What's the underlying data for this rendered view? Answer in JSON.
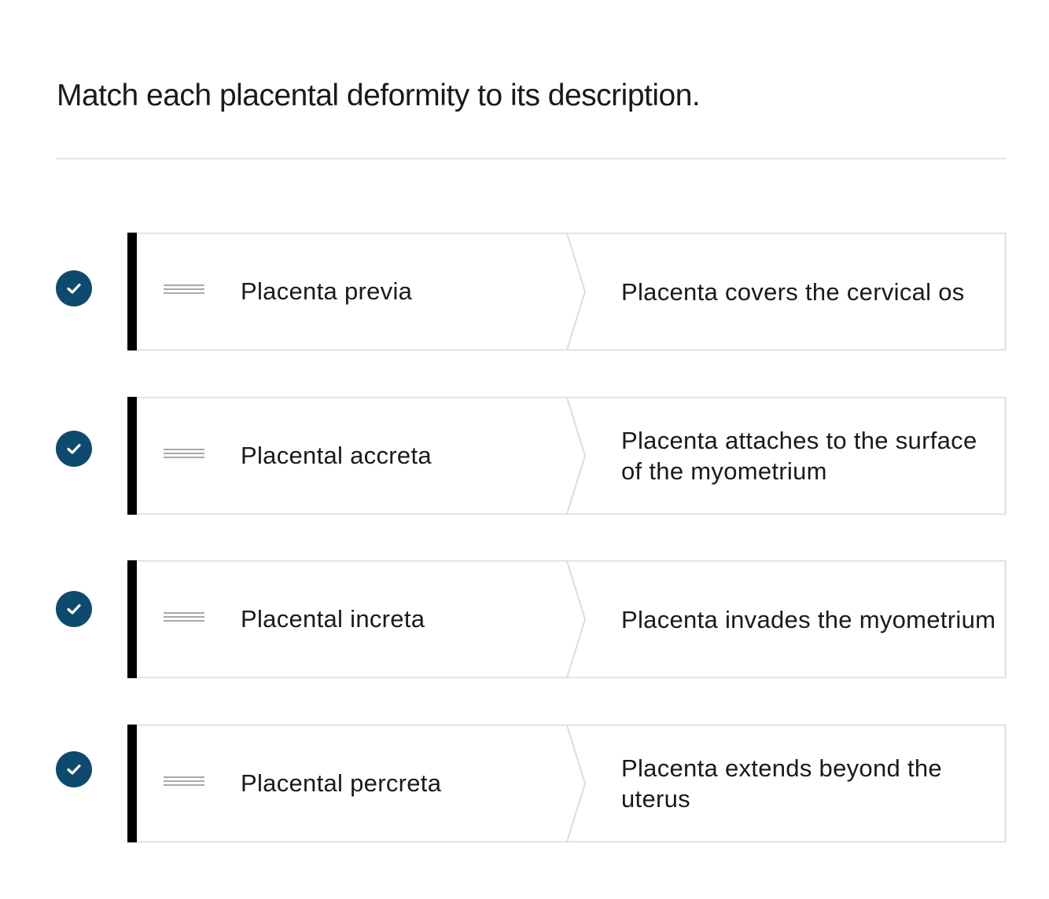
{
  "question": {
    "prompt": "Match each placental deformity to its description."
  },
  "colors": {
    "check_fill": "#0e4a6e",
    "card_border": "#dcdcdc",
    "accent_bar": "#000000"
  },
  "pairs": [
    {
      "term": "Placenta previa",
      "description": "Placenta covers the cervical os",
      "status_icon": "check-icon"
    },
    {
      "term": "Placental accreta",
      "description": "Placenta attaches to the surface of the myometrium",
      "status_icon": "check-icon"
    },
    {
      "term": "Placental increta",
      "description": "Placenta invades the myometrium",
      "status_icon": "check-icon"
    },
    {
      "term": "Placental percreta",
      "description": "Placenta extends beyond the uterus",
      "status_icon": "check-icon"
    }
  ]
}
